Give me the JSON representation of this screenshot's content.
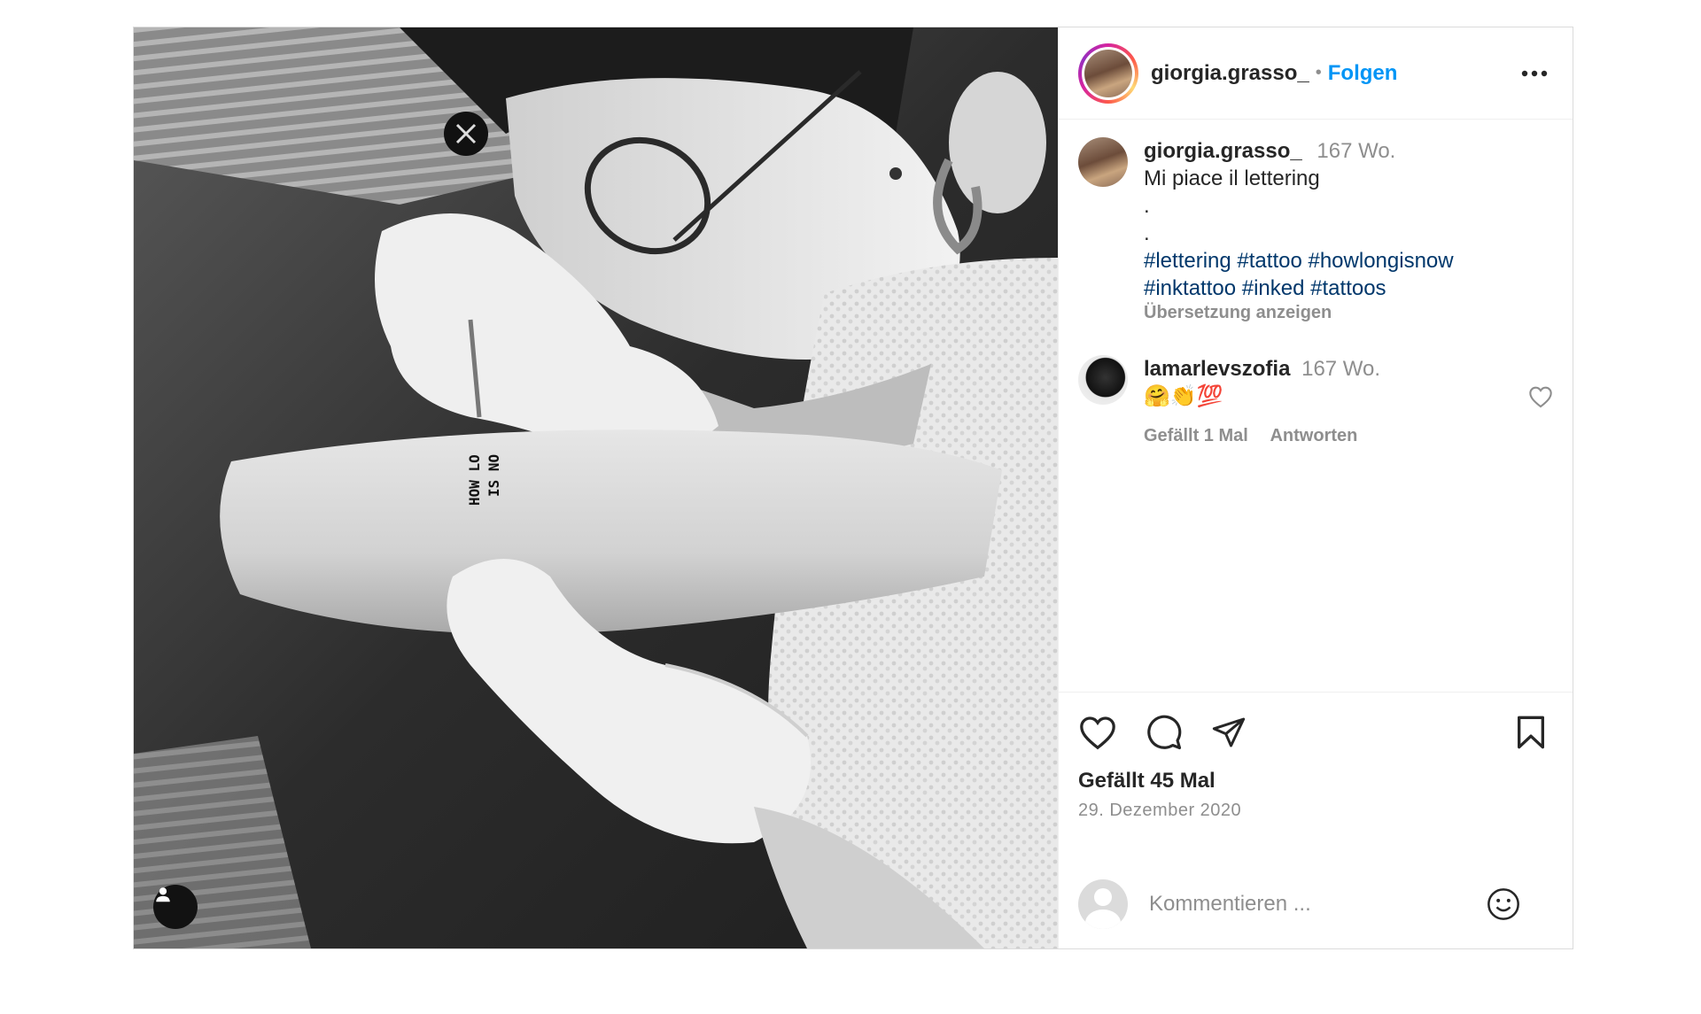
{
  "post": {
    "author": {
      "username": "giorgia.grasso_",
      "follow_label": "Folgen",
      "separator": "•"
    },
    "caption": {
      "username": "giorgia.grasso_",
      "time": "167 Wo.",
      "text": "Mi piace il lettering",
      "dots": [
        ".",
        "."
      ],
      "hashtags_line1": [
        "#lettering",
        "#tattoo",
        "#howlongisnow"
      ],
      "hashtags_line2": [
        "#inktattoo",
        "#inked",
        "#tattoos"
      ],
      "translate_label": "Übersetzung anzeigen"
    },
    "comments": [
      {
        "username": "lamarlevszofia",
        "time": "167 Wo.",
        "text": "🤗👏💯",
        "likes_label": "Gefällt 1 Mal",
        "reply_label": "Antworten"
      }
    ],
    "likes_label": "Gefällt 45 Mal",
    "date": "29. Dezember 2020",
    "comment_input": {
      "placeholder": "Kommentieren ..."
    },
    "image_tattoo_text": [
      "HOW LO",
      "IS NO"
    ],
    "colors": {
      "accent": "#0095f6",
      "hashtag": "#00376b",
      "muted": "#8e8e8e",
      "border": "#dbdbdb"
    },
    "icons": [
      "user-tag-icon",
      "more-options-icon",
      "heart-icon",
      "comment-icon",
      "share-icon",
      "bookmark-icon",
      "smiley-icon"
    ]
  }
}
